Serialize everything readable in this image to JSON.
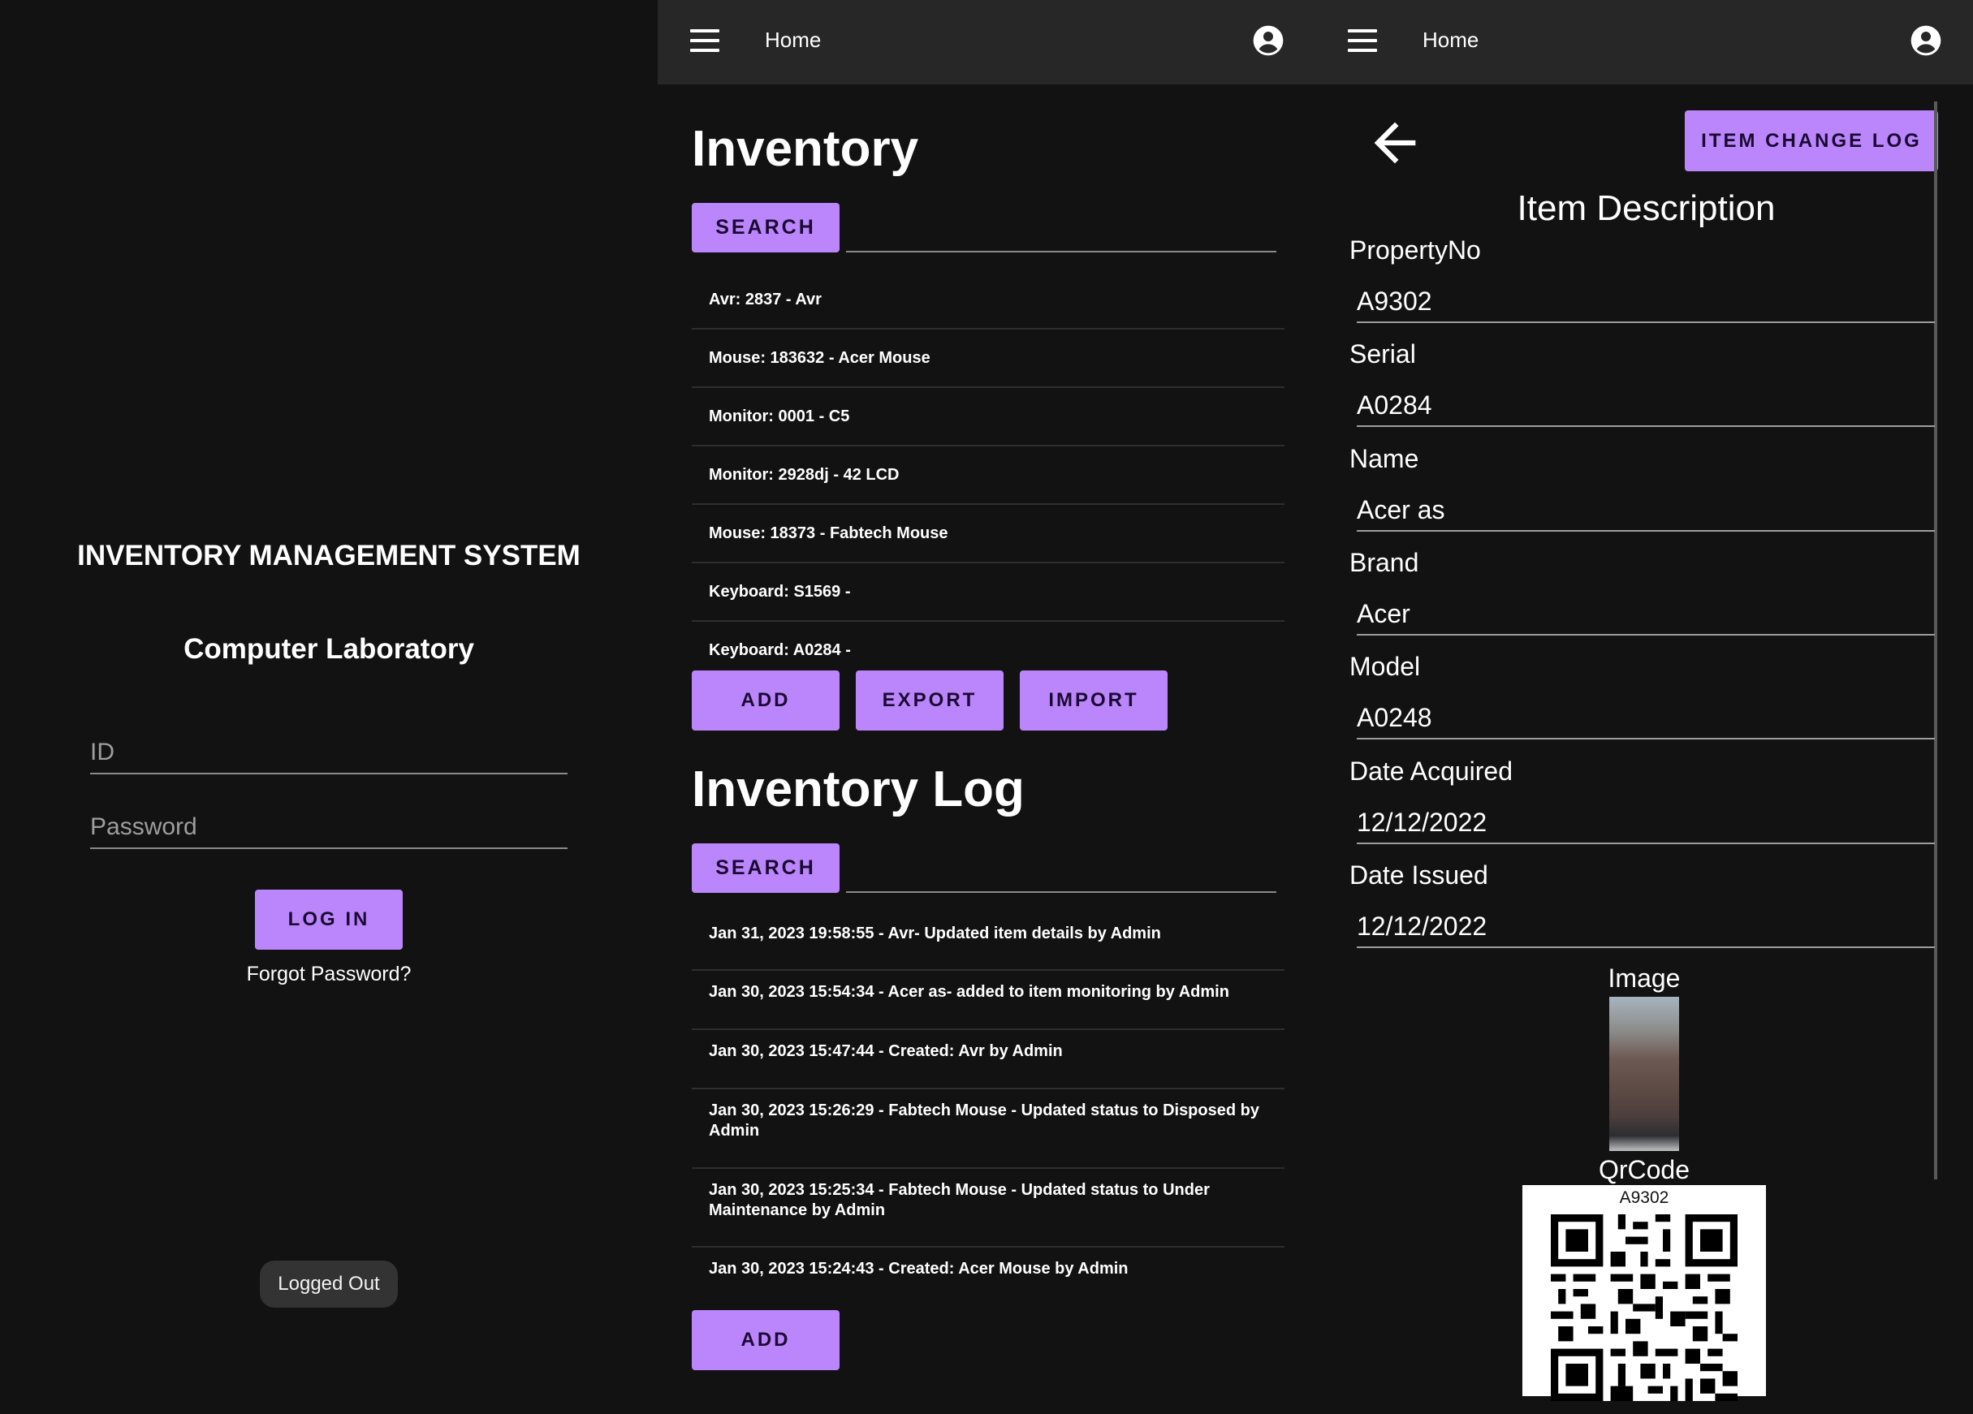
{
  "login": {
    "title": "INVENTORY MANAGEMENT SYSTEM",
    "subtitle": "Computer Laboratory",
    "id_placeholder": "ID",
    "password_placeholder": "Password",
    "login_button": "LOG IN",
    "forgot_link": "Forgot Password?",
    "toast": "Logged Out"
  },
  "appbar": {
    "title": "Home"
  },
  "inventory": {
    "heading": "Inventory",
    "search_button": "SEARCH",
    "items": [
      "Avr: 2837 - Avr",
      "Mouse: 183632 - Acer Mouse",
      "Monitor: 0001 - C5",
      "Monitor: 2928dj - 42 LCD",
      "Mouse: 18373 - Fabtech Mouse",
      "Keyboard: S1569 -",
      "Keyboard: A0284 -"
    ],
    "add_button": "ADD",
    "export_button": "EXPORT",
    "import_button": "IMPORT"
  },
  "inventory_log": {
    "heading": "Inventory Log",
    "search_button": "SEARCH",
    "entries": [
      "Jan 31, 2023 19:58:55 - Avr- Updated item details by Admin",
      "Jan 30, 2023 15:54:34 - Acer as- added to item monitoring by Admin",
      "Jan 30, 2023 15:47:44 - Created: Avr by Admin",
      "Jan 30, 2023 15:26:29 - Fabtech Mouse - Updated status to Disposed by Admin",
      "Jan 30, 2023 15:25:34 - Fabtech Mouse - Updated status to Under Maintenance by Admin",
      "Jan 30, 2023 15:24:43 - Created: Acer Mouse by Admin"
    ],
    "add_button": "ADD"
  },
  "detail": {
    "change_log_button": "ITEM CHANGE LOG",
    "title": "Item Description",
    "fields": [
      {
        "label": "PropertyNo",
        "value": "A9302"
      },
      {
        "label": "Serial",
        "value": "A0284"
      },
      {
        "label": "Name",
        "value": "Acer as"
      },
      {
        "label": "Brand",
        "value": "Acer"
      },
      {
        "label": "Model",
        "value": "A0248"
      },
      {
        "label": "Date Acquired",
        "value": "12/12/2022"
      },
      {
        "label": "Date Issued",
        "value": "12/12/2022"
      }
    ],
    "image_label": "Image",
    "qrcode_label": "QrCode",
    "qrcode_text": "A9302"
  },
  "colors": {
    "background": "#121212",
    "appbar": "#272727",
    "accent": "#bb86fc"
  }
}
